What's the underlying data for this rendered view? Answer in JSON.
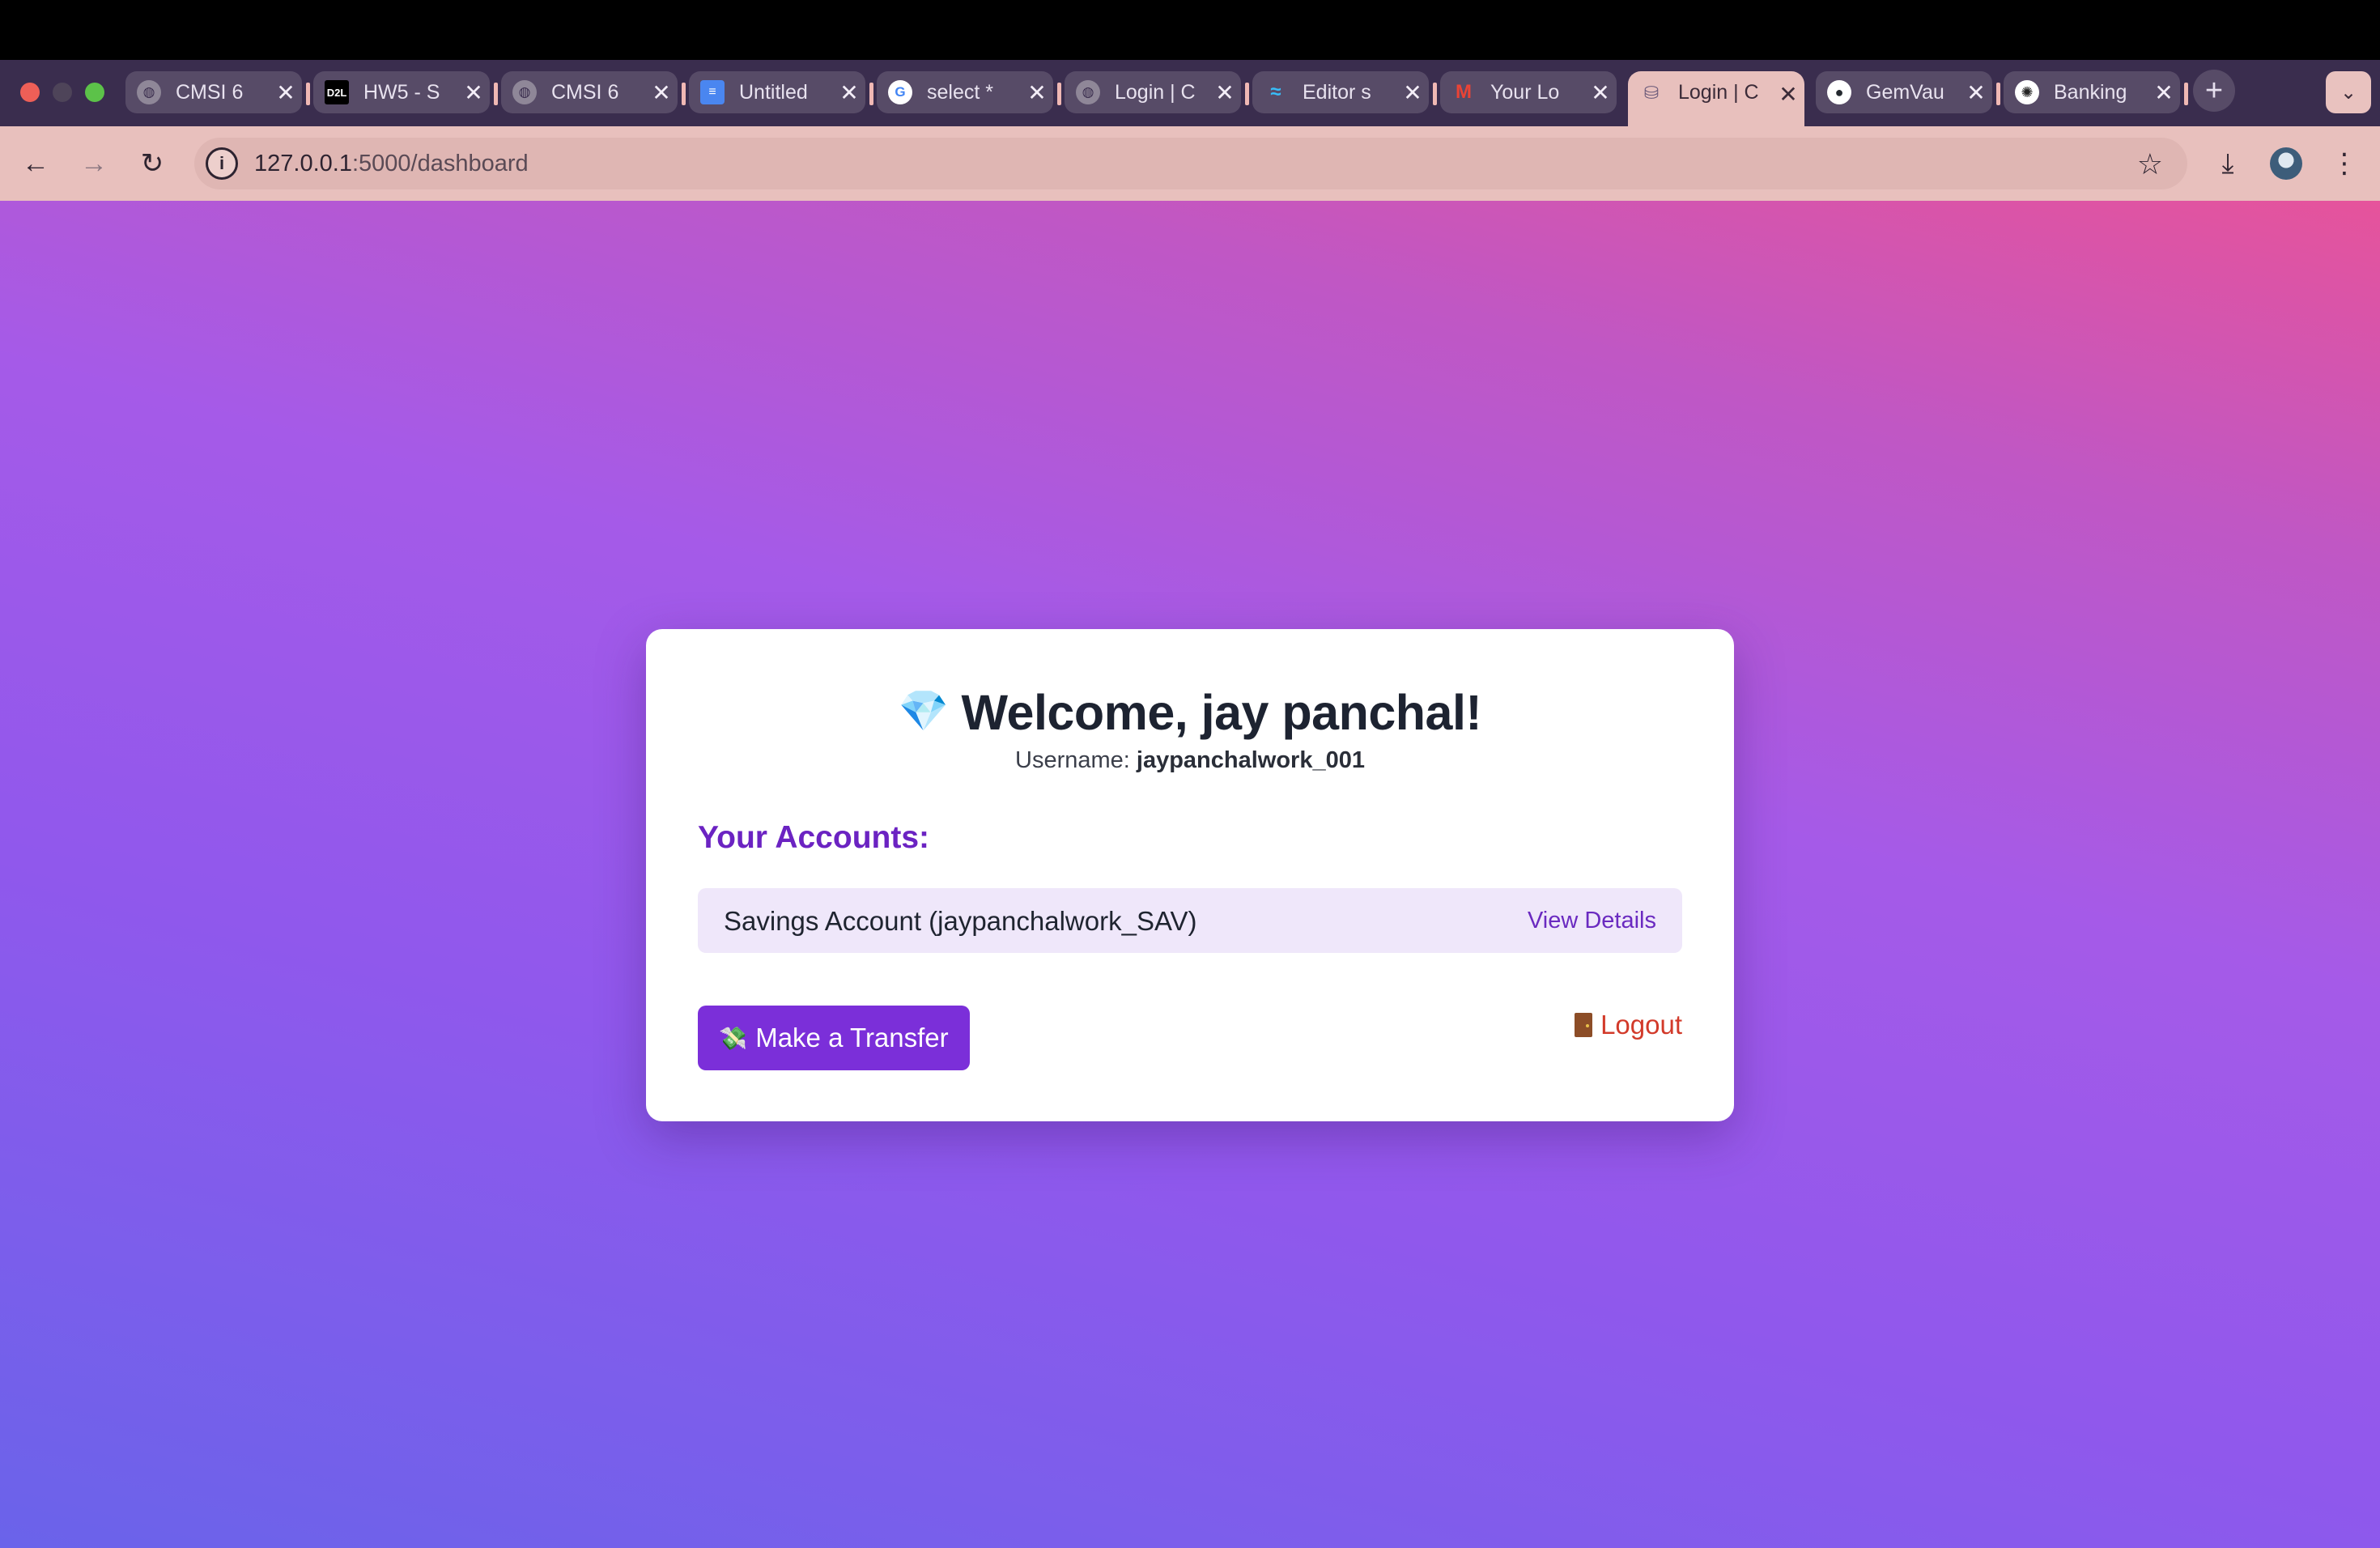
{
  "browser": {
    "tabs": [
      {
        "title": "CMSI 6",
        "favicon": "globe-icon",
        "active": false
      },
      {
        "title": "HW5 - S",
        "favicon": "d2l-icon",
        "active": false
      },
      {
        "title": "CMSI 6",
        "favicon": "globe-icon",
        "active": false
      },
      {
        "title": "Untitled",
        "favicon": "docs-icon",
        "active": false
      },
      {
        "title": "select *",
        "favicon": "google-icon",
        "active": false
      },
      {
        "title": "Login | C",
        "favicon": "globe-icon",
        "active": false
      },
      {
        "title": "Editor s",
        "favicon": "tailwind-icon",
        "active": false
      },
      {
        "title": "Your Lo",
        "favicon": "gmail-icon",
        "active": false
      },
      {
        "title": "Login | C",
        "favicon": "banking-icon",
        "active": true
      },
      {
        "title": "GemVau",
        "favicon": "github-icon",
        "active": false
      },
      {
        "title": "Banking",
        "favicon": "openai-icon",
        "active": false
      }
    ],
    "url_host": "127.0.0.1",
    "url_path": ":5000/dashboard"
  },
  "dashboard": {
    "welcome": "Welcome, jay panchal!",
    "gem_emoji": "💎",
    "username_label": "Username:",
    "username": "jaypanchalwork_001",
    "accounts_heading": "Your Accounts:",
    "accounts": [
      {
        "name": "Savings Account (jaypanchalwork_SAV)",
        "link": "View Details"
      }
    ],
    "transfer_emoji": "💸",
    "transfer_label": "Make a Transfer",
    "logout_label": "Logout"
  },
  "colors": {
    "accent": "#7b2fd9",
    "heading": "#6b23c2",
    "logout": "#d23a2a"
  }
}
